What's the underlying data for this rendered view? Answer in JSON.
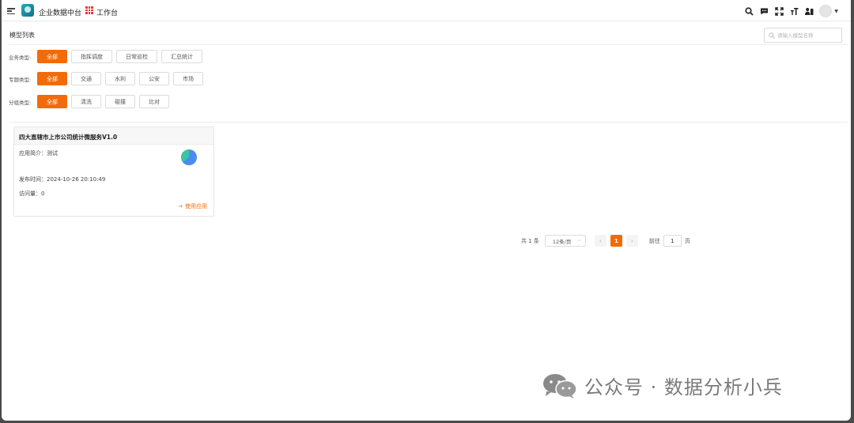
{
  "header": {
    "app_title": "企业数据中台",
    "workspace_label": "工作台",
    "tools": [
      "search-icon",
      "message-icon",
      "fullscreen-icon",
      "font-size-icon",
      "user-switch-icon"
    ]
  },
  "page": {
    "section_title": "模型列表",
    "search": {
      "placeholder": "请输入模型名称",
      "value": ""
    }
  },
  "filters": [
    {
      "label": "业务类型:",
      "options": [
        "全部",
        "指挥调度",
        "日常巡检",
        "汇总统计"
      ],
      "active": 0
    },
    {
      "label": "专题类型:",
      "options": [
        "全部",
        "交通",
        "水利",
        "公安",
        "市场"
      ],
      "active": 0
    },
    {
      "label": "分组类型:",
      "options": [
        "全部",
        "清洗",
        "碰撞",
        "比对"
      ],
      "active": 0
    }
  ],
  "cards": [
    {
      "title": "四大直辖市上市公司统计微服务V1.0",
      "intro": "应用简介：测试",
      "published": "发布时间：2024-10-26 20:10:49",
      "visits": "访问量：0",
      "action": "使用应用"
    }
  ],
  "pagination": {
    "total": "共 1 条",
    "page_size": "12条/页",
    "current": "1",
    "goto_label": "前往",
    "goto_value": "1",
    "page_suffix": "页"
  },
  "watermark": {
    "text": "公众号 · 数据分析小兵"
  },
  "colors": {
    "accent": "#f26b0a",
    "logo": "#1a8fa3",
    "workspace_icon": "#e53935"
  }
}
